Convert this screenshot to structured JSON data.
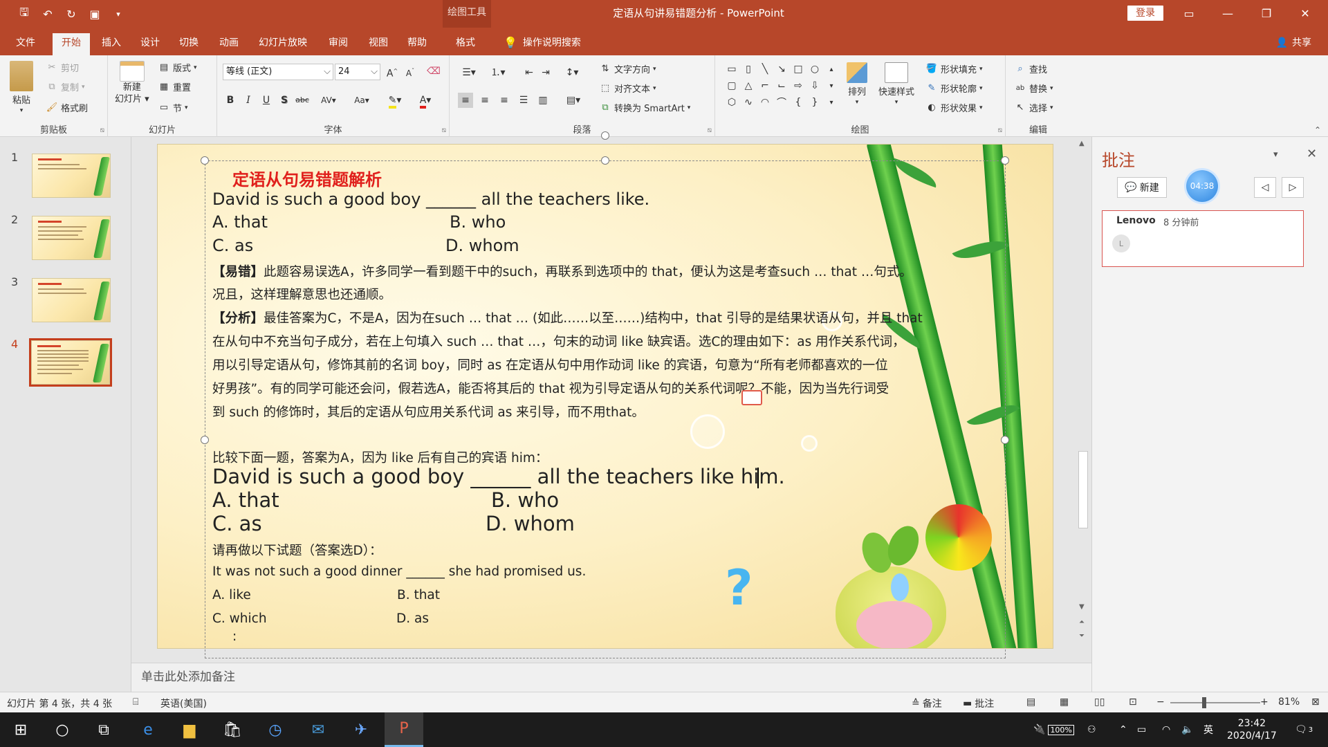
{
  "titlebar": {
    "context_tool": "绘图工具",
    "doc_title": "定语从句讲易错题分析 - PowerPoint",
    "login": "登录"
  },
  "tabs": [
    "文件",
    "开始",
    "插入",
    "设计",
    "切换",
    "动画",
    "幻灯片放映",
    "审阅",
    "视图",
    "帮助",
    "格式"
  ],
  "active_tab": "开始",
  "tell_me": "操作说明搜索",
  "share": "共享",
  "ribbon": {
    "clipboard": {
      "label": "剪贴板",
      "paste": "粘贴",
      "cut": "剪切",
      "copy": "复制",
      "format_painter": "格式刷"
    },
    "slides": {
      "label": "幻灯片",
      "new_slide_1": "新建",
      "new_slide_2": "幻灯片",
      "layout": "版式",
      "reset": "重置",
      "section": "节"
    },
    "font": {
      "label": "字体",
      "font_name": "等线 (正文)",
      "font_size": "24"
    },
    "paragraph": {
      "label": "段落",
      "text_direction": "文字方向",
      "align_text": "对齐文本",
      "smartart": "转换为 SmartArt"
    },
    "drawing": {
      "label": "绘图",
      "arrange": "排列",
      "quick_styles": "快速样式",
      "shape_fill": "形状填充",
      "shape_outline": "形状轮廓",
      "shape_effects": "形状效果"
    },
    "editing": {
      "label": "编辑",
      "find": "查找",
      "replace": "替换",
      "select": "选择"
    }
  },
  "slides_panel": [
    {
      "number": "1"
    },
    {
      "number": "2"
    },
    {
      "number": "3"
    },
    {
      "number": "4"
    }
  ],
  "slide": {
    "title": "定语从句易错题解析",
    "q1": "David is such a good boy ______ all the teachers like.",
    "q1_a": "A. that",
    "q1_b": "B. who",
    "q1_c": "C. as",
    "q1_d": "D. whom",
    "easy_wrong_tag": "【易错】",
    "easy_wrong_1": "此题容易误选A，许多同学一看到题干中的such，再联系到选项中的 that，便认为这是考查such … that …句式。",
    "easy_wrong_2": "况且，这样理解意思也还通顺。",
    "analysis_tag": "【分析】",
    "analysis_1": "最佳答案为C，不是A，因为在such … that … (如此……以至……)结构中，that 引导的是结果状语从句，并且 that",
    "analysis_2": "在从句中不充当句子成分，若在上句填入 such … that …，句末的动词 like 缺宾语。选C的理由如下：as 用作关系代词，",
    "analysis_3": "用以引导定语从句，修饰其前的名词 boy，同时 as 在定语从句中用作动词 like 的宾语，句意为“所有老师都喜欢的一位",
    "analysis_4": "好男孩”。有的同学可能还会问，假若选A，能否将其后的 that 视为引导定语从句的关系代词呢？不能，因为当先行词受",
    "analysis_5": "到 such 的修饰时，其后的定语从句应用关系代词 as 来引导，而不用that。",
    "compare": "比较下面一题，答案为A，因为 like 后有自己的宾语 him：",
    "q2": "David is such a good boy ______ all the teachers like him.",
    "q2_a": "A. that",
    "q2_b": "B. who",
    "q2_c": "C. as",
    "q2_d": "D. whom",
    "try": "请再做以下试题（答案选D）：",
    "q3": "It was not such a good dinner ______ she had promised us.",
    "q3_a": "A. like",
    "q3_b": "B. that",
    "q3_c": "C. which",
    "q3_d": "D. as",
    "tail": ":"
  },
  "notes_placeholder": "单击此处添加备注",
  "comments": {
    "title": "批注",
    "new_button": "新建",
    "timer": "04:38",
    "author": "Lenovo",
    "time": "8 分钟前",
    "avatar_letter": "L"
  },
  "statusbar": {
    "slide_info": "幻灯片 第 4 张，共 4 张",
    "language": "英语(美国)",
    "notes": "备注",
    "comments": "批注",
    "zoom": "81%"
  },
  "taskbar": {
    "battery": "100%",
    "ime": "英",
    "clock_time": "23:42",
    "clock_date": "2020/4/17",
    "notifications": "3"
  },
  "colors": {
    "accent": "#b7472a",
    "slide_title": "#e0201c"
  }
}
